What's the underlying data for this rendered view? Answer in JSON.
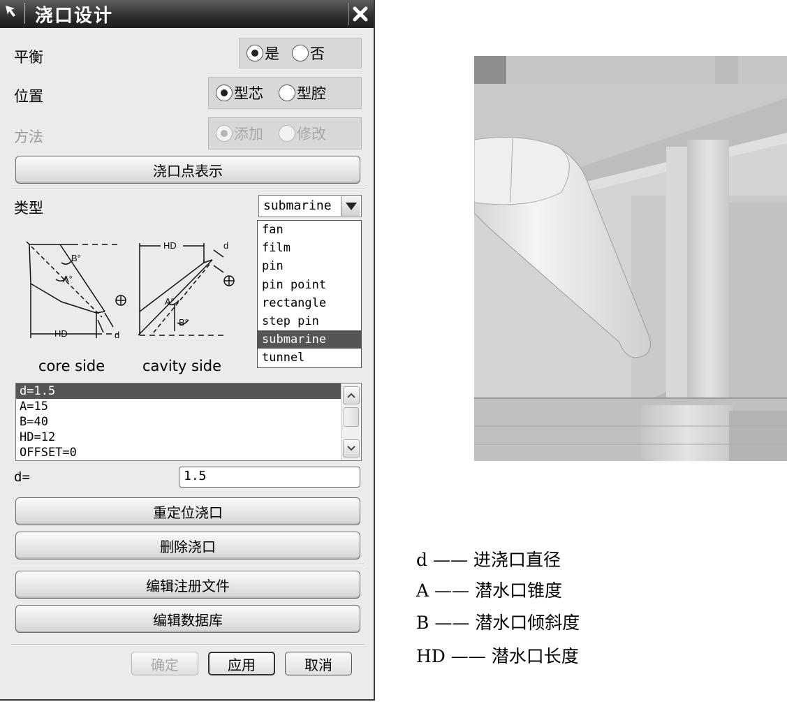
{
  "dialog": {
    "title": "浇口设计",
    "balance": {
      "label": "平衡",
      "options": [
        "是",
        "否"
      ],
      "selected": 0
    },
    "position": {
      "label": "位置",
      "options": [
        "型芯",
        "型腔"
      ],
      "selected": 0
    },
    "method": {
      "label": "方法",
      "options": [
        "添加",
        "修改"
      ],
      "selected": 0,
      "disabled": true
    },
    "gate_point_button": "浇口点表示",
    "type": {
      "label": "类型",
      "value": "submarine",
      "options": [
        "fan",
        "film",
        "pin",
        "pin point",
        "rectangle",
        "step pin",
        "submarine",
        "tunnel"
      ],
      "highlighted": "submarine"
    },
    "diagram": {
      "caption_left": "core side",
      "caption_right": "cavity side",
      "labels": {
        "B": "B°",
        "A": "A°",
        "HD": "HD",
        "d": "d"
      }
    },
    "params": [
      "d=1.5",
      "A=15",
      "B=40",
      "HD=12",
      "OFFSET=0"
    ],
    "param_selected": 0,
    "edit_label": "d=",
    "edit_value": "1.5",
    "buttons": {
      "reposition": "重定位浇口",
      "delete": "删除浇口",
      "edit_register": "编辑注册文件",
      "edit_database": "编辑数据库"
    },
    "footer": {
      "ok": "确定",
      "apply": "应用",
      "cancel": "取消"
    }
  },
  "legend": [
    {
      "symbol": "d",
      "text": "进浇口直径"
    },
    {
      "symbol": "A",
      "text": "潜水口锥度"
    },
    {
      "symbol": "B",
      "text": "潜水口倾斜度"
    },
    {
      "symbol": "HD",
      "text": "潜水口长度"
    }
  ],
  "colors": {
    "titlebar": "#2e2e2e",
    "dialog_bg": "#ebebeb",
    "selection": "#555555",
    "view_bg": "#d6d6d6"
  }
}
